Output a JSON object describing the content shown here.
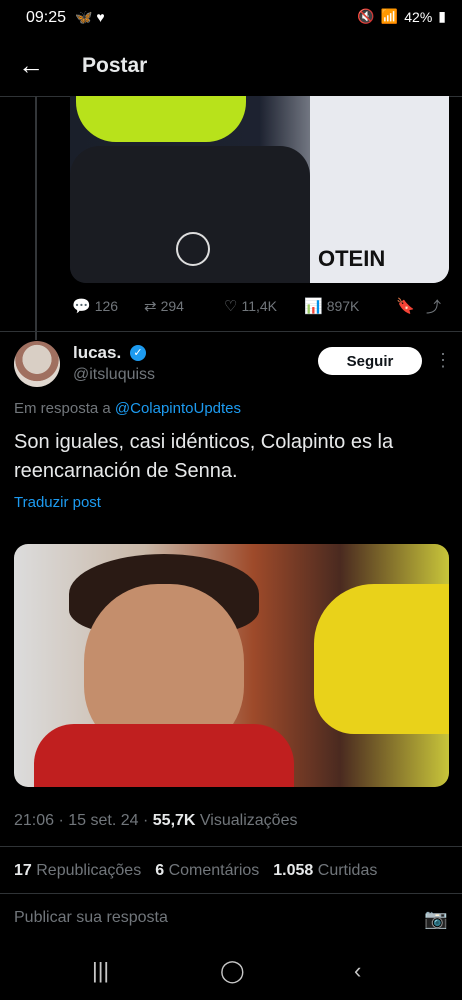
{
  "status_bar": {
    "time": "09:25",
    "left_icons": "🦋 ♥",
    "battery": "42%"
  },
  "header": {
    "title": "Postar"
  },
  "prev_post": {
    "replies": "126",
    "reposts": "294",
    "likes": "11,4K",
    "views": "897K",
    "image_text": "OTEIN"
  },
  "post": {
    "name": "lucas.",
    "handle": "@itsluquiss",
    "follow_label": "Seguir",
    "reply_prefix": "Em resposta a",
    "reply_to": "@ColapintoUpdtes",
    "text": "Son iguales, casi idénticos, Colapinto es la reencarnación de Senna.",
    "translate": "Traduzir post",
    "time": "21:06 · 15 set. 24 ·",
    "views_count": "55,7K",
    "views_label": "Visualizações"
  },
  "stats": {
    "reposts_count": "17",
    "reposts_label": "Republicações",
    "comments_count": "6",
    "comments_label": "Comentários",
    "likes_count": "1.058",
    "likes_label": "Curtidas"
  },
  "compose": {
    "placeholder": "Publicar sua resposta"
  },
  "colors": {
    "accent": "#1d9bf0",
    "background": "#000000",
    "text": "#e7e9ea",
    "muted": "#71767b"
  }
}
